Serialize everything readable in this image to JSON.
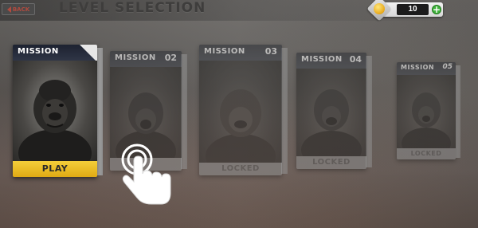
{
  "header": {
    "back_label": "BACK",
    "title": "LEVEL SELECTION"
  },
  "currency": {
    "coins": "10",
    "add_label": "+"
  },
  "missions": [
    {
      "label": "MISSION",
      "number": "",
      "status": "PLAY",
      "locked": false
    },
    {
      "label": "MISSION",
      "number": "02",
      "status": "",
      "locked": true
    },
    {
      "label": "MISSION",
      "number": "03",
      "status": "LOCKED",
      "locked": true
    },
    {
      "label": "MISSION",
      "number": "04",
      "status": "LOCKED",
      "locked": true
    },
    {
      "label": "MISSION",
      "number": "05",
      "status": "LOCKED",
      "locked": true
    }
  ],
  "colors": {
    "play_accent": "#f2c52b",
    "back_text": "#b14b3f",
    "add_button": "#3fb23a"
  },
  "icons": {
    "coin": "coin-icon",
    "hand": "tap-hand-icon"
  }
}
